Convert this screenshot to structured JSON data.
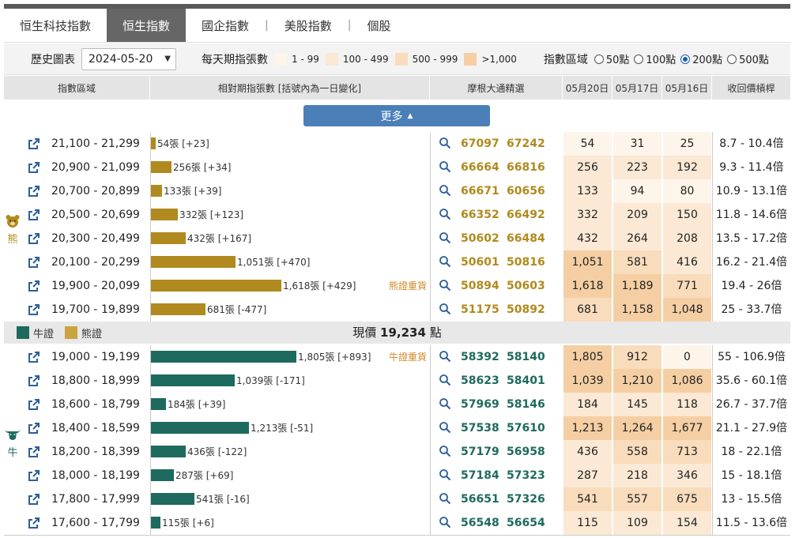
{
  "tabs": [
    "恒生科技指數",
    "恒生指數",
    "國企指數",
    "美股指數",
    "個股"
  ],
  "active_tab": 1,
  "controls": {
    "history_label": "歷史圖表",
    "date": "2024-05-20",
    "legend_title": "每天期指張數",
    "legend": [
      {
        "label": "1 - 99",
        "color": "#fdf5ea"
      },
      {
        "label": "100 - 499",
        "color": "#fbe9d5"
      },
      {
        "label": "500 - 999",
        "color": "#f8dcbc"
      },
      {
        "label": ">1,000",
        "color": "#f5cfa3"
      }
    ],
    "range_title": "指數區域",
    "range_options": [
      "50點",
      "100點",
      "200點",
      "500點"
    ],
    "range_selected": 2
  },
  "header": {
    "col_range": "指數區域",
    "col_bar": "相對期指張數 [括號內為一日變化]",
    "col_select": "摩根大通精選",
    "col_d1": "05月20日",
    "col_d2": "05月17日",
    "col_d3": "05月16日",
    "col_ratio": "收回價槓桿"
  },
  "more_label": "更多",
  "colors": {
    "bear": "#b08a1e",
    "bull": "#1e6a5e",
    "tag": "#d08a2a",
    "link_icon": "#2d5f9a"
  },
  "bear_side": {
    "icon": "bear-icon",
    "label": "熊"
  },
  "bull_side": {
    "icon": "bull-icon",
    "label": "牛"
  },
  "bear_rows": [
    {
      "range": "21,100 - 21,299",
      "count": 54,
      "bar_label": "54張 [+23]",
      "tag": "",
      "code1": "67097",
      "code2": "67242",
      "d1": "54",
      "d2": "31",
      "d3": "25",
      "ratio": "8.7 - 10.4倍"
    },
    {
      "range": "20,900 - 21,099",
      "count": 256,
      "bar_label": "256張 [+34]",
      "tag": "",
      "code1": "66664",
      "code2": "66816",
      "d1": "256",
      "d2": "223",
      "d3": "192",
      "ratio": "9.3 - 11.4倍"
    },
    {
      "range": "20,700 - 20,899",
      "count": 133,
      "bar_label": "133張 [+39]",
      "tag": "",
      "code1": "66671",
      "code2": "60656",
      "d1": "133",
      "d2": "94",
      "d3": "80",
      "ratio": "10.9 - 13.1倍"
    },
    {
      "range": "20,500 - 20,699",
      "count": 332,
      "bar_label": "332張 [+123]",
      "tag": "",
      "code1": "66352",
      "code2": "66492",
      "d1": "332",
      "d2": "209",
      "d3": "150",
      "ratio": "11.8 - 14.6倍"
    },
    {
      "range": "20,300 - 20,499",
      "count": 432,
      "bar_label": "432張 [+167]",
      "tag": "",
      "code1": "50602",
      "code2": "66484",
      "d1": "432",
      "d2": "264",
      "d3": "208",
      "ratio": "13.5 - 17.2倍"
    },
    {
      "range": "20,100 - 20,299",
      "count": 1051,
      "bar_label": "1,051張 [+470]",
      "tag": "",
      "code1": "50601",
      "code2": "50816",
      "d1": "1,051",
      "d2": "581",
      "d3": "416",
      "ratio": "16.2 - 21.4倍"
    },
    {
      "range": "19,900 - 20,099",
      "count": 1618,
      "bar_label": "1,618張 [+429]",
      "tag": "熊證重貨",
      "code1": "50894",
      "code2": "50603",
      "d1": "1,618",
      "d2": "1,189",
      "d3": "771",
      "ratio": "19.4 - 26倍"
    },
    {
      "range": "19,700 - 19,899",
      "count": 681,
      "bar_label": "681張 [-477]",
      "tag": "",
      "code1": "51175",
      "code2": "50892",
      "d1": "681",
      "d2": "1,158",
      "d3": "1,048",
      "ratio": "25 - 33.7倍"
    }
  ],
  "separator": {
    "bull_label": "牛證",
    "bear_label": "熊證",
    "price_prefix": "現價",
    "price_value": "19,234",
    "price_unit": "點"
  },
  "bull_rows": [
    {
      "range": "19,000 - 19,199",
      "count": 1805,
      "bar_label": "1,805張 [+893]",
      "tag": "牛證重貨",
      "code1": "58392",
      "code2": "58140",
      "d1": "1,805",
      "d2": "912",
      "d3": "0",
      "ratio": "55 - 106.9倍"
    },
    {
      "range": "18,800 - 18,999",
      "count": 1039,
      "bar_label": "1,039張 [-171]",
      "tag": "",
      "code1": "58623",
      "code2": "58401",
      "d1": "1,039",
      "d2": "1,210",
      "d3": "1,086",
      "ratio": "35.6 - 60.1倍"
    },
    {
      "range": "18,600 - 18,799",
      "count": 184,
      "bar_label": "184張 [+39]",
      "tag": "",
      "code1": "57969",
      "code2": "58146",
      "d1": "184",
      "d2": "145",
      "d3": "118",
      "ratio": "26.7 - 37.7倍"
    },
    {
      "range": "18,400 - 18,599",
      "count": 1213,
      "bar_label": "1,213張 [-51]",
      "tag": "",
      "code1": "57538",
      "code2": "57610",
      "d1": "1,213",
      "d2": "1,264",
      "d3": "1,677",
      "ratio": "21.1 - 27.9倍"
    },
    {
      "range": "18,200 - 18,399",
      "count": 436,
      "bar_label": "436張 [-122]",
      "tag": "",
      "code1": "57179",
      "code2": "56958",
      "d1": "436",
      "d2": "558",
      "d3": "713",
      "ratio": "18 - 22.1倍"
    },
    {
      "range": "18,000 - 18,199",
      "count": 287,
      "bar_label": "287張 [+69]",
      "tag": "",
      "code1": "57184",
      "code2": "57323",
      "d1": "287",
      "d2": "218",
      "d3": "346",
      "ratio": "15 - 18.1倍"
    },
    {
      "range": "17,800 - 17,999",
      "count": 541,
      "bar_label": "541張 [-16]",
      "tag": "",
      "code1": "56651",
      "code2": "57326",
      "d1": "541",
      "d2": "557",
      "d3": "675",
      "ratio": "13 - 15.5倍"
    },
    {
      "range": "17,600 - 17,799",
      "count": 115,
      "bar_label": "115張 [+6]",
      "tag": "",
      "code1": "56548",
      "code2": "56654",
      "d1": "115",
      "d2": "109",
      "d3": "154",
      "ratio": "11.5 - 13.6倍"
    }
  ]
}
